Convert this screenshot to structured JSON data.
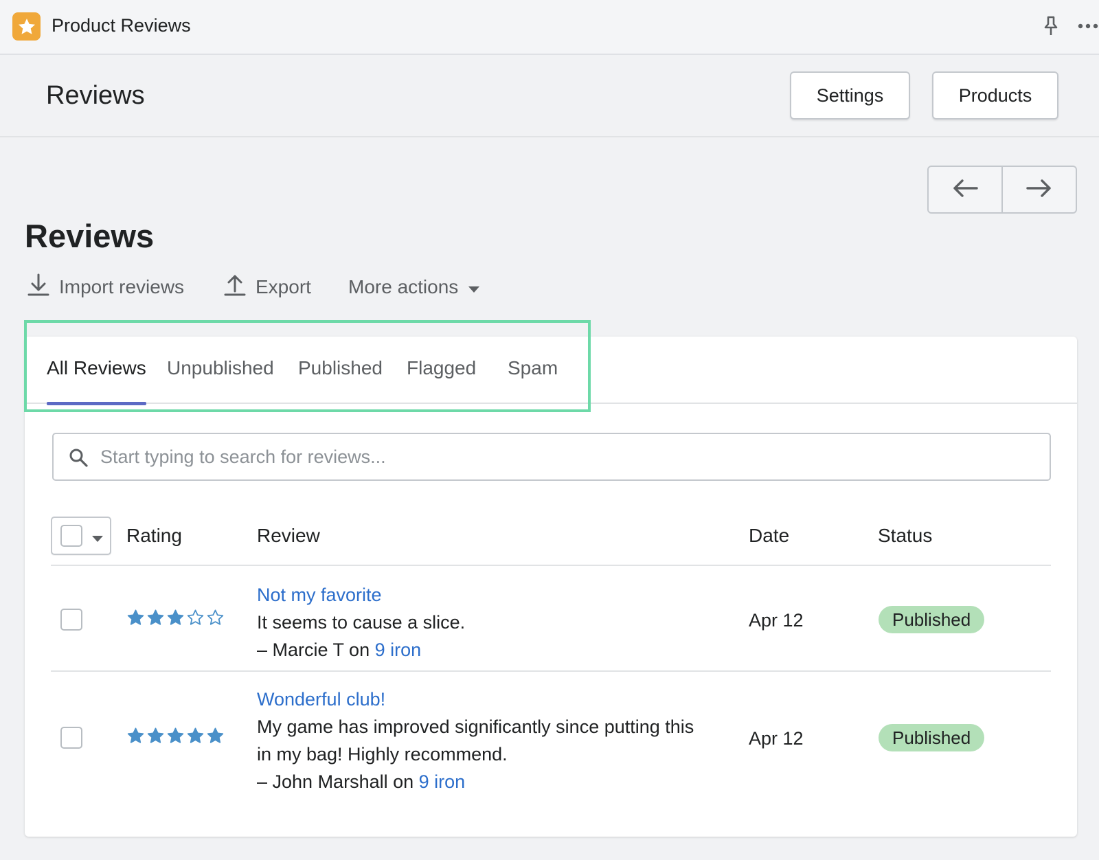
{
  "app": {
    "title": "Product Reviews"
  },
  "header": {
    "title": "Reviews",
    "settings_label": "Settings",
    "products_label": "Products"
  },
  "page": {
    "title": "Reviews"
  },
  "actions": {
    "import_label": "Import reviews",
    "export_label": "Export",
    "more_label": "More actions"
  },
  "tabs": [
    {
      "label": "All Reviews",
      "active": true
    },
    {
      "label": "Unpublished",
      "active": false
    },
    {
      "label": "Published",
      "active": false
    },
    {
      "label": "Flagged",
      "active": false
    },
    {
      "label": "Spam",
      "active": false
    }
  ],
  "search": {
    "placeholder": "Start typing to search for reviews...",
    "value": ""
  },
  "table": {
    "columns": {
      "rating": "Rating",
      "review": "Review",
      "date": "Date",
      "status": "Status"
    },
    "rows": [
      {
        "rating": 3,
        "title": "Not my favorite",
        "body_lines": [
          "It seems to cause a slice."
        ],
        "author_prefix": "– Marcie T on ",
        "product": "9 iron",
        "date": "Apr 12",
        "status": "Published"
      },
      {
        "rating": 5,
        "title": "Wonderful club!",
        "body_lines": [
          "My game has improved significantly since putting this",
          "in my bag! Highly recommend."
        ],
        "author_prefix": "– John Marshall on ",
        "product": "9 iron",
        "date": "Apr 12",
        "status": "Published"
      }
    ]
  },
  "colors": {
    "accent_tab": "#5c6ac4",
    "link": "#2c6ecb",
    "star": "#4a90c9",
    "badge_published": "#b3e0b8",
    "highlight": "#6dd9a8",
    "logo": "#f0a83a"
  },
  "icons": {
    "logo": "star-icon",
    "pin": "pin-icon",
    "more": "ellipsis-icon",
    "prev": "arrow-left-icon",
    "next": "arrow-right-icon",
    "import": "download-icon",
    "export": "upload-icon",
    "more_actions": "caret-down-icon",
    "search": "search-icon"
  }
}
